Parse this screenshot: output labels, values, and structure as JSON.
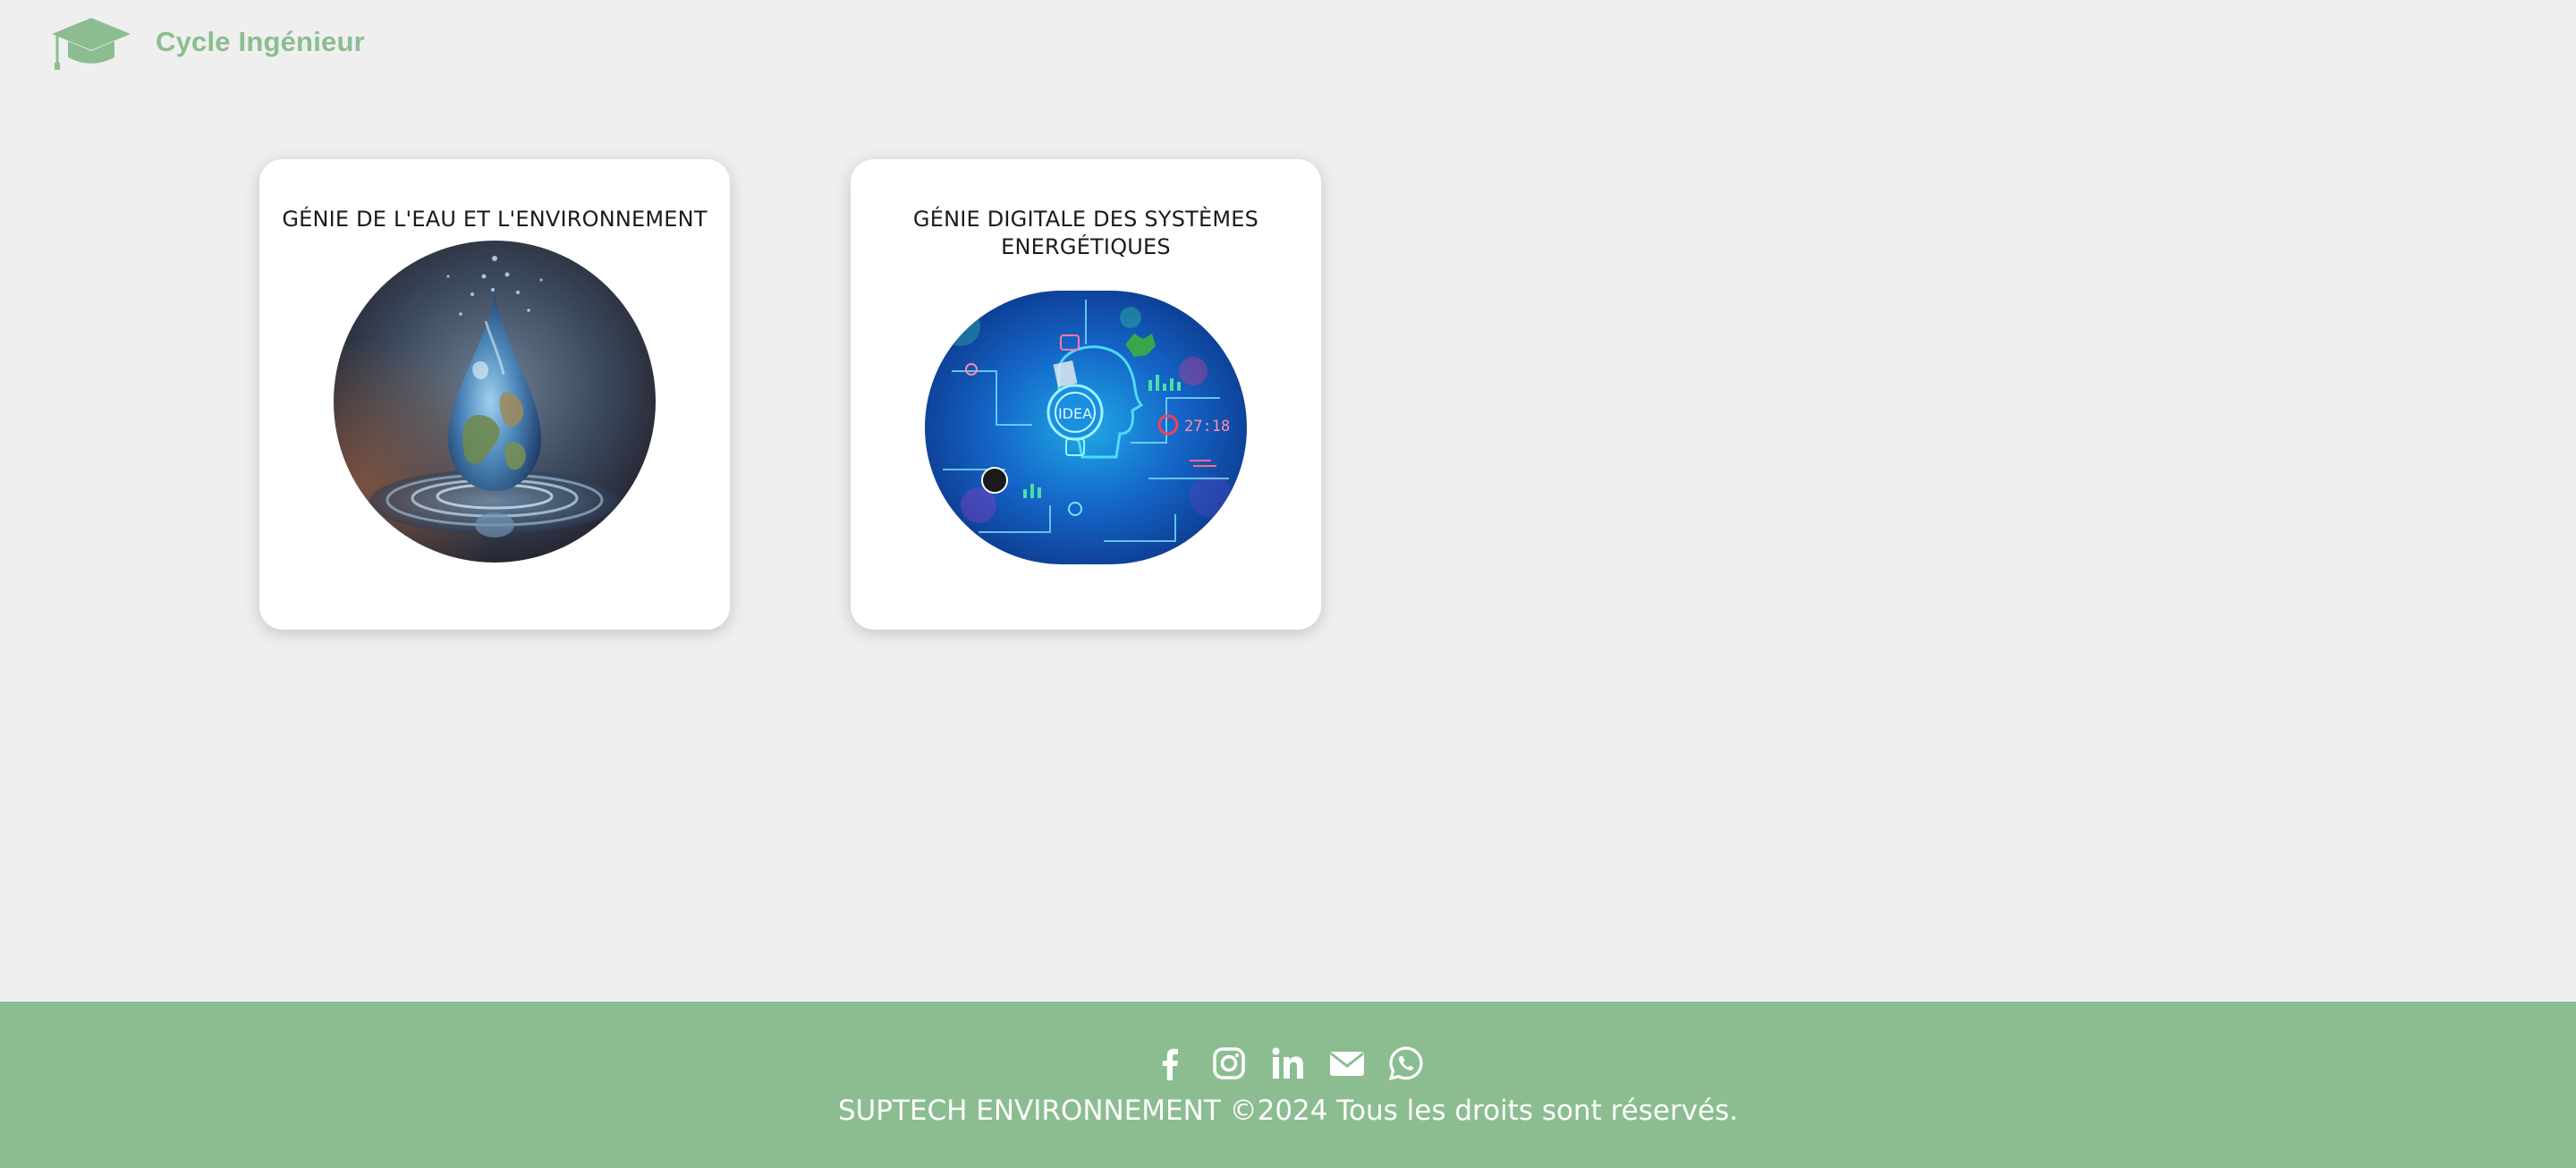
{
  "header": {
    "brand": "Cycle Ingénieur",
    "brand_color": "#8bbd91"
  },
  "cards": [
    {
      "title": "GÉNIE DE L'EAU ET L'ENVIRONNEMENT",
      "image": "water-drop-earth-image"
    },
    {
      "title": "GÉNIE DIGITALE DES SYSTÈMES ENERGÉTIQUES",
      "image": "digital-idea-energy-image"
    }
  ],
  "footer": {
    "background": "#8bbd91",
    "social_icons": [
      "facebook-icon",
      "instagram-icon",
      "linkedin-icon",
      "email-icon",
      "whatsapp-icon"
    ],
    "copyright": "SUPTECH ENVIRONNEMENT ©2024 Tous les droits sont réservés."
  },
  "image_text": {
    "idea": "IDEA",
    "clock": "27:18"
  }
}
